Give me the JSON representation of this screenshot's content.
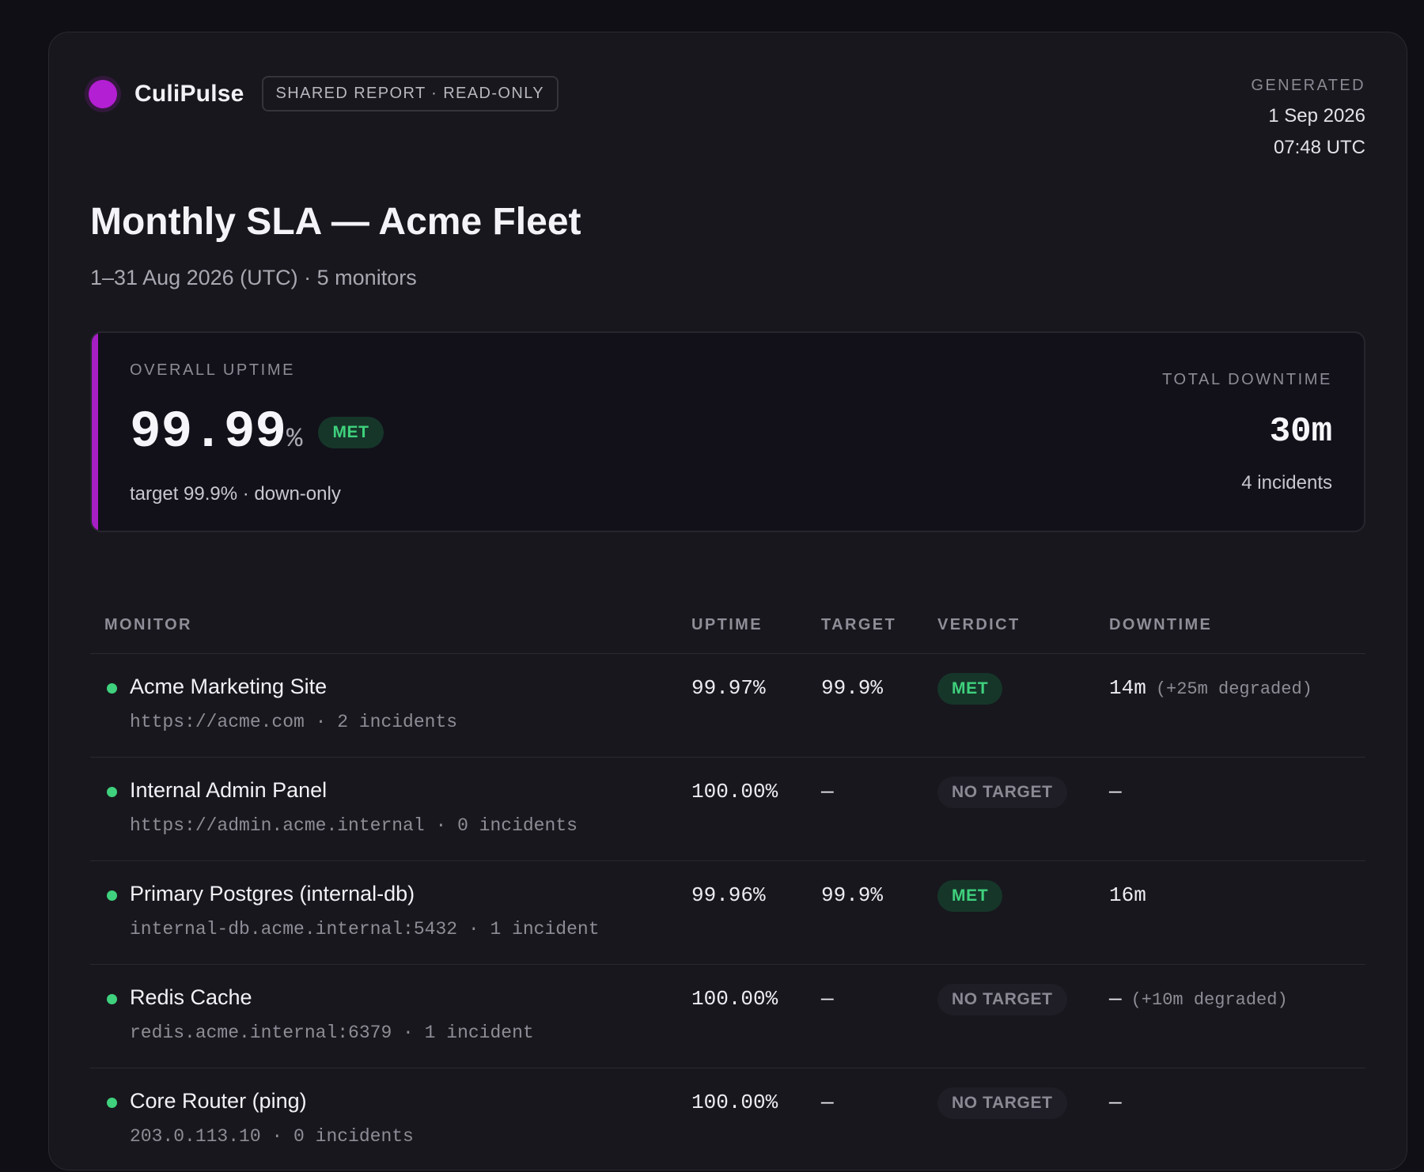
{
  "brand": {
    "name": "CuliPulse",
    "badge": "SHARED REPORT · READ-ONLY"
  },
  "generated": {
    "label": "GENERATED",
    "date": "1 Sep 2026",
    "time": "07:48 UTC"
  },
  "report": {
    "title": "Monthly SLA — Acme Fleet",
    "subtitle": "1–31 Aug 2026 (UTC) · 5 monitors"
  },
  "summary": {
    "uptime_label": "OVERALL UPTIME",
    "uptime_value": "99.99",
    "uptime_unit": "%",
    "verdict": "MET",
    "target_text": "target 99.9% · down-only",
    "downtime_label": "TOTAL DOWNTIME",
    "downtime_value": "30m",
    "incidents_text": "4 incidents"
  },
  "table": {
    "headers": {
      "monitor": "MONITOR",
      "uptime": "UPTIME",
      "target": "TARGET",
      "verdict": "VERDICT",
      "downtime": "DOWNTIME"
    },
    "rows": [
      {
        "name": "Acme Marketing Site",
        "meta": "https://acme.com · 2 incidents",
        "uptime": "99.97%",
        "target": "99.9%",
        "verdict": "MET",
        "verdict_kind": "met",
        "downtime": "14m",
        "degraded": "(+25m degraded)"
      },
      {
        "name": "Internal Admin Panel",
        "meta": "https://admin.acme.internal · 0 incidents",
        "uptime": "100.00%",
        "target": "—",
        "verdict": "NO TARGET",
        "verdict_kind": "none",
        "downtime": "—",
        "degraded": ""
      },
      {
        "name": "Primary Postgres (internal-db)",
        "meta": "internal-db.acme.internal:5432 · 1 incident",
        "uptime": "99.96%",
        "target": "99.9%",
        "verdict": "MET",
        "verdict_kind": "met",
        "downtime": "16m",
        "degraded": ""
      },
      {
        "name": "Redis Cache",
        "meta": "redis.acme.internal:6379 · 1 incident",
        "uptime": "100.00%",
        "target": "—",
        "verdict": "NO TARGET",
        "verdict_kind": "none",
        "downtime": "—",
        "degraded": "(+10m degraded)"
      },
      {
        "name": "Core Router (ping)",
        "meta": "203.0.113.10 · 0 incidents",
        "uptime": "100.00%",
        "target": "—",
        "verdict": "NO TARGET",
        "verdict_kind": "none",
        "downtime": "—",
        "degraded": ""
      }
    ]
  },
  "colors": {
    "accent": "#b31fd2",
    "status_up": "#3fd17d",
    "met_bg": "#16362a",
    "background": "#18171d"
  }
}
